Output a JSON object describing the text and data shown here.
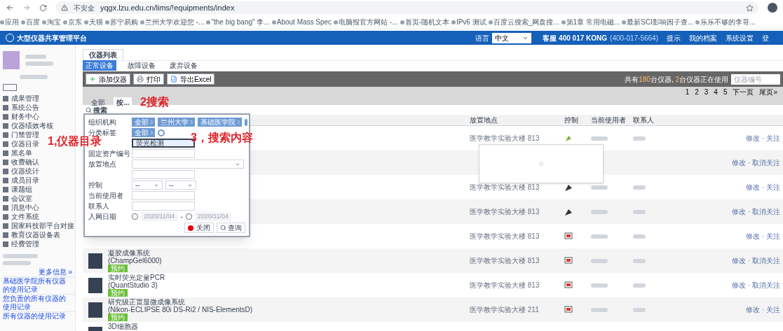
{
  "browser": {
    "security": "不安全",
    "url": "yqgx.lzu.edu.cn/lims/!equipments/index"
  },
  "bookmarks": [
    "应用",
    "百度",
    "淘宝",
    "京东",
    "天猫",
    "苏宁易购",
    "兰州大学欢迎您 -...",
    "\"the big bang\" 李...",
    "About Mass Spec",
    "电脑报官方网站 -...",
    "首页-随机文本",
    "IPv6 测试",
    "百度云搜索_网盘搜...",
    "第1章 常用电磁...",
    "最新SCI影响因子查...",
    "乐乐不够的李哥..."
  ],
  "header": {
    "title": "大型仪器共享管理平台",
    "language_label": "语言",
    "language": "中文",
    "hotline": "客服 400 017 KONG",
    "hotline_number": "(400-017-5664)",
    "items": [
      "提示",
      "我的档案",
      "系统设置",
      "登"
    ]
  },
  "sidebar": {
    "menu": [
      "成果管理",
      "系统公告",
      "财务中心",
      "仪器绩效考核",
      "门禁管理",
      "仪器目录",
      "黑名单",
      "收费确认",
      "仪器统计",
      "成员目录",
      "课题组",
      "会议室",
      "消息中心",
      "文件系统",
      "国家科技部平台对接",
      "教育仪器设备表",
      "经费管理"
    ],
    "more": "更多信息 »",
    "links": [
      "基础医学院所有仪器的使用记录",
      "您负责的所有仪器的使用记录",
      "所有仪器的使用记录"
    ]
  },
  "page_tab": "仪器列表",
  "sub_tabs": [
    {
      "label": "正常设备",
      "selected": true
    },
    {
      "label": "故障设备",
      "selected": false
    },
    {
      "label": "废弃设备",
      "selected": false
    }
  ],
  "toolbar": [
    "添加仪器",
    "打印",
    "导出Excel"
  ],
  "summary": {
    "prefix": "共有",
    "total": "180",
    "middle": "台仪器, ",
    "using": "2",
    "suffix": "台仪器正在使用",
    "search_placeholder": "仪器编号"
  },
  "pagination": [
    "1",
    "2",
    "3",
    "4",
    "5",
    "下一页",
    "尾页»"
  ],
  "filter_tabs": [
    {
      "label": "全部",
      "selected": false
    },
    {
      "label": "按...",
      "selected": true
    }
  ],
  "search_label": "搜索",
  "columns": [
    "放置地点",
    "控制",
    "当前使用者",
    "联系人"
  ],
  "rows": [
    {
      "location": "医学教学实验大楼 813",
      "kind": "online",
      "actions": "修改 · 关注"
    },
    {
      "actions": "修改 · 取消关注"
    },
    {
      "location": "医学教学实验大楼 813",
      "kind": "offline",
      "actions": "修改 · 关注"
    },
    {
      "location": "医学教学实验大楼 813",
      "kind": "offline",
      "actions": "修改 · 取消关注"
    },
    {
      "location": "医学教学实验大楼 813",
      "kind": "computer",
      "actions": "修改 · 关注"
    },
    {
      "name": "凝胶成像系统",
      "model": "(ChampGel6000)",
      "badge": "预约",
      "location": "医学教学实验大楼 813",
      "kind": "computer",
      "actions": "修改 · 取消关注"
    },
    {
      "name": "实时荧光定量PCR",
      "model": "(QuantStudio 3)",
      "badge": "预约",
      "location": "医学教学实验大楼 813",
      "kind": "computer",
      "actions": "修改 · 取消关注"
    },
    {
      "name": "研究级正置显微成像系统",
      "model": "(Nikon-ECLIPSE 80i DS-Ri2 / NIS-ElementsD)",
      "badge": "预约",
      "location": "医学教学实验大楼 211",
      "kind": "computer",
      "actions": "修改 · 关注"
    },
    {
      "name": "3D细胞器"
    }
  ],
  "search_popup": {
    "org_label": "组织机构",
    "org_path": [
      "全部",
      "兰州大学",
      "基础医学院"
    ],
    "tag_label": "分类标签",
    "tag_path": [
      "全部"
    ],
    "name_value": "荧光检测",
    "asset_label": "固定资产编号",
    "place_label": "放置地点",
    "control_label": "控制",
    "control_values": [
      "--",
      "--"
    ],
    "user_label": "当前使用者",
    "contact_label": "联系人",
    "date_label": "入网日期",
    "dates": [
      {
        "value": "2020/11/04",
        "checked": false
      },
      {
        "value": "2020/11/04",
        "checked": false
      }
    ],
    "date_sep": "-",
    "close": "关闭",
    "query": "查询"
  },
  "annotations": [
    "1,仪器目录",
    "2搜索",
    "3，搜索内容"
  ]
}
